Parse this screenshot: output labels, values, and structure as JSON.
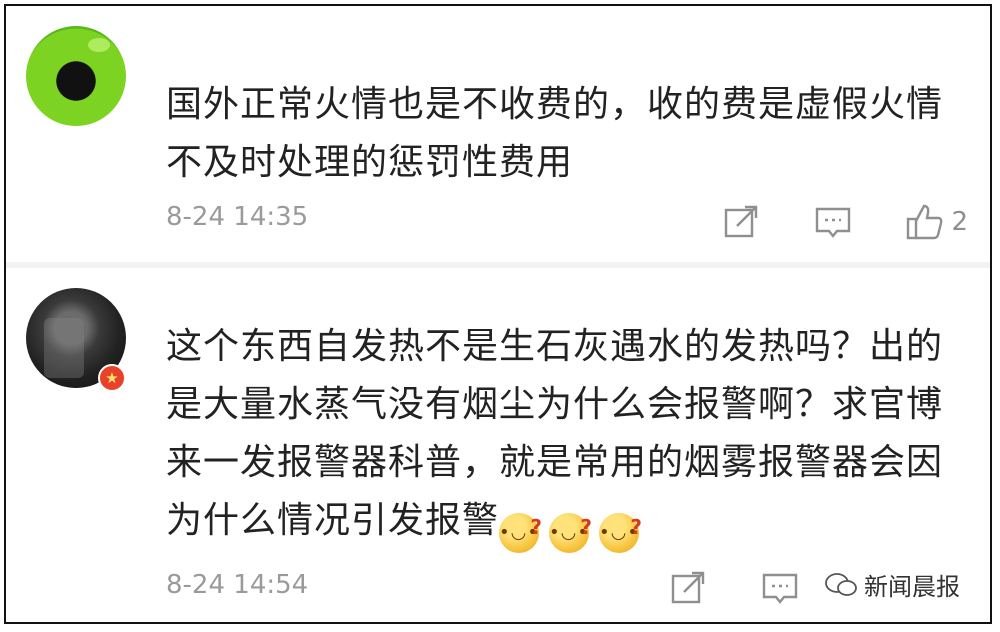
{
  "comments": [
    {
      "text": "国外正常火情也是不收费的，收的费是虚假火情不及时处理的惩罚性费用",
      "timestamp": "8-24 14:35",
      "likes": "2",
      "avatar_color": "#7dd321"
    },
    {
      "text": "这个东西自发热不是生石灰遇水的发热吗？出的是大量水蒸气没有烟尘为什么会报警啊？求官博来一发报警器科普，就是常用的烟雾报警器会因为什么情况引发报警",
      "emojis": [
        "thinking-emoji",
        "thinking-emoji",
        "thinking-emoji"
      ],
      "timestamp": "8-24 14:54",
      "badge_color": "#e8412c"
    }
  ],
  "icons": {
    "share": "share-icon",
    "comment": "comment-icon",
    "like": "thumbs-up-icon"
  },
  "watermark": {
    "text": "新闻晨报"
  }
}
